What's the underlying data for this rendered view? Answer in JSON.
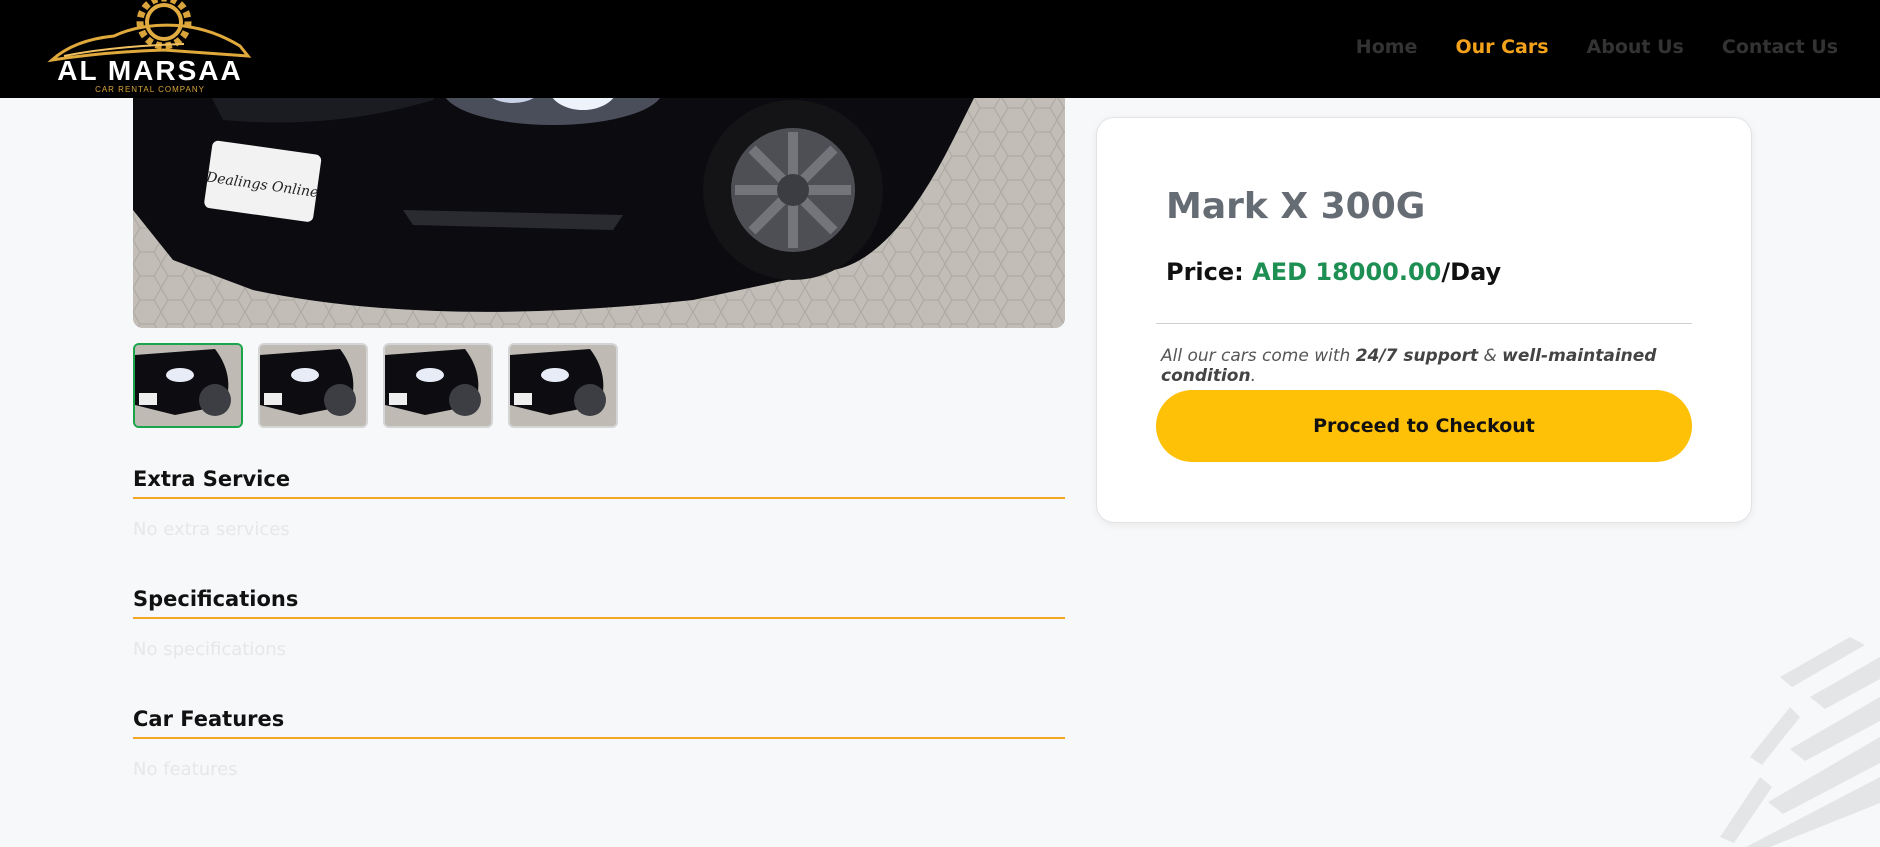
{
  "brand": {
    "name": "AL MARSAA",
    "tagline": "CAR RENTAL COMPANY",
    "accent": "#f5a21b"
  },
  "nav": {
    "items": [
      {
        "label": "Home",
        "active": false
      },
      {
        "label": "Our Cars",
        "active": true
      },
      {
        "label": "About Us",
        "active": false
      },
      {
        "label": "Contact Us",
        "active": false
      }
    ]
  },
  "gallery": {
    "plate_text": "Dealings Online",
    "thumbnail_count": 4,
    "selected_index": 0
  },
  "car": {
    "name": "Mark X 300G",
    "price_label": "Price:",
    "price_value": "AED 18000.00",
    "price_unit": "/Day",
    "note_prefix": "All our cars come with",
    "note_bold1": "24/7 support",
    "note_mid": "&",
    "note_bold2": "well-maintained condition",
    "note_suffix": ".",
    "checkout_label": "Proceed to Checkout"
  },
  "sections": {
    "extra": {
      "title": "Extra Service",
      "empty": "No extra services"
    },
    "specs": {
      "title": "Specifications",
      "empty": "No specifications"
    },
    "features": {
      "title": "Car Features",
      "empty": "No features"
    }
  },
  "colors": {
    "navbar": "#000000",
    "price_green": "#1e8f52",
    "button_yellow": "#ffc008",
    "section_underline": "#f5a623",
    "thumb_selected": "#1aa54a"
  }
}
